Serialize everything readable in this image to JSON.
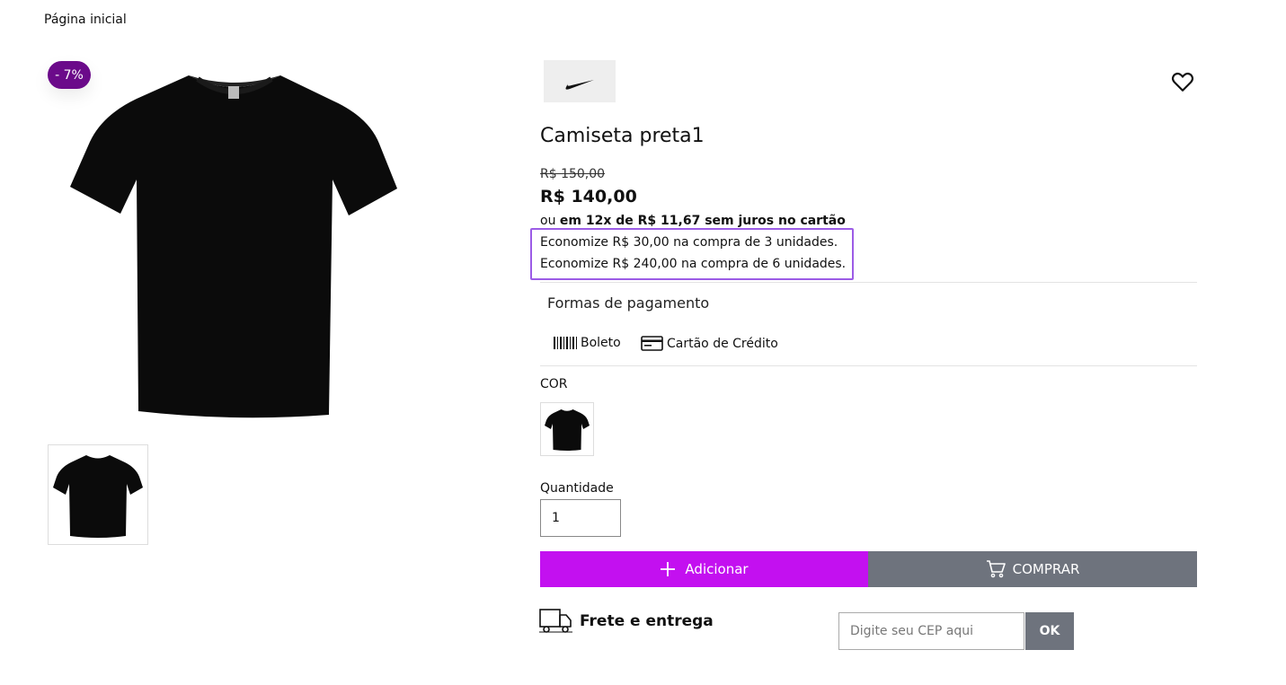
{
  "breadcrumb": {
    "home": "Página inicial"
  },
  "gallery": {
    "discount_badge": "- 7%"
  },
  "product": {
    "brand": "NIKE",
    "title": "Camiseta preta1",
    "old_price": "R$ 150,00",
    "price": "R$ 140,00",
    "installments_prefix": "ou",
    "installments_bold": "em 12x de R$ 11,67 sem juros no cartão",
    "savings": [
      "Economize R$ 30,00 na compra de 3 unidades.",
      "Economize R$ 240,00 na compra de 6 unidades."
    ]
  },
  "payment": {
    "heading": "Formas de pagamento",
    "methods": [
      {
        "label": "Boleto",
        "icon": "barcode-icon"
      },
      {
        "label": "Cartão de Crédito",
        "icon": "credit-card-icon"
      }
    ]
  },
  "color": {
    "label": "COR"
  },
  "quantity": {
    "label": "Quantidade",
    "value": "1"
  },
  "actions": {
    "add_label": "Adicionar",
    "buy_label": "COMPRAR"
  },
  "shipping": {
    "title": "Frete e entrega",
    "cep_placeholder": "Digite seu CEP aqui",
    "ok_label": "OK"
  },
  "colors": {
    "accent": "#c310f0",
    "badge": "#6b0a8a",
    "secondary_button": "#6e737d",
    "highlight_border": "#9c5ce6"
  }
}
